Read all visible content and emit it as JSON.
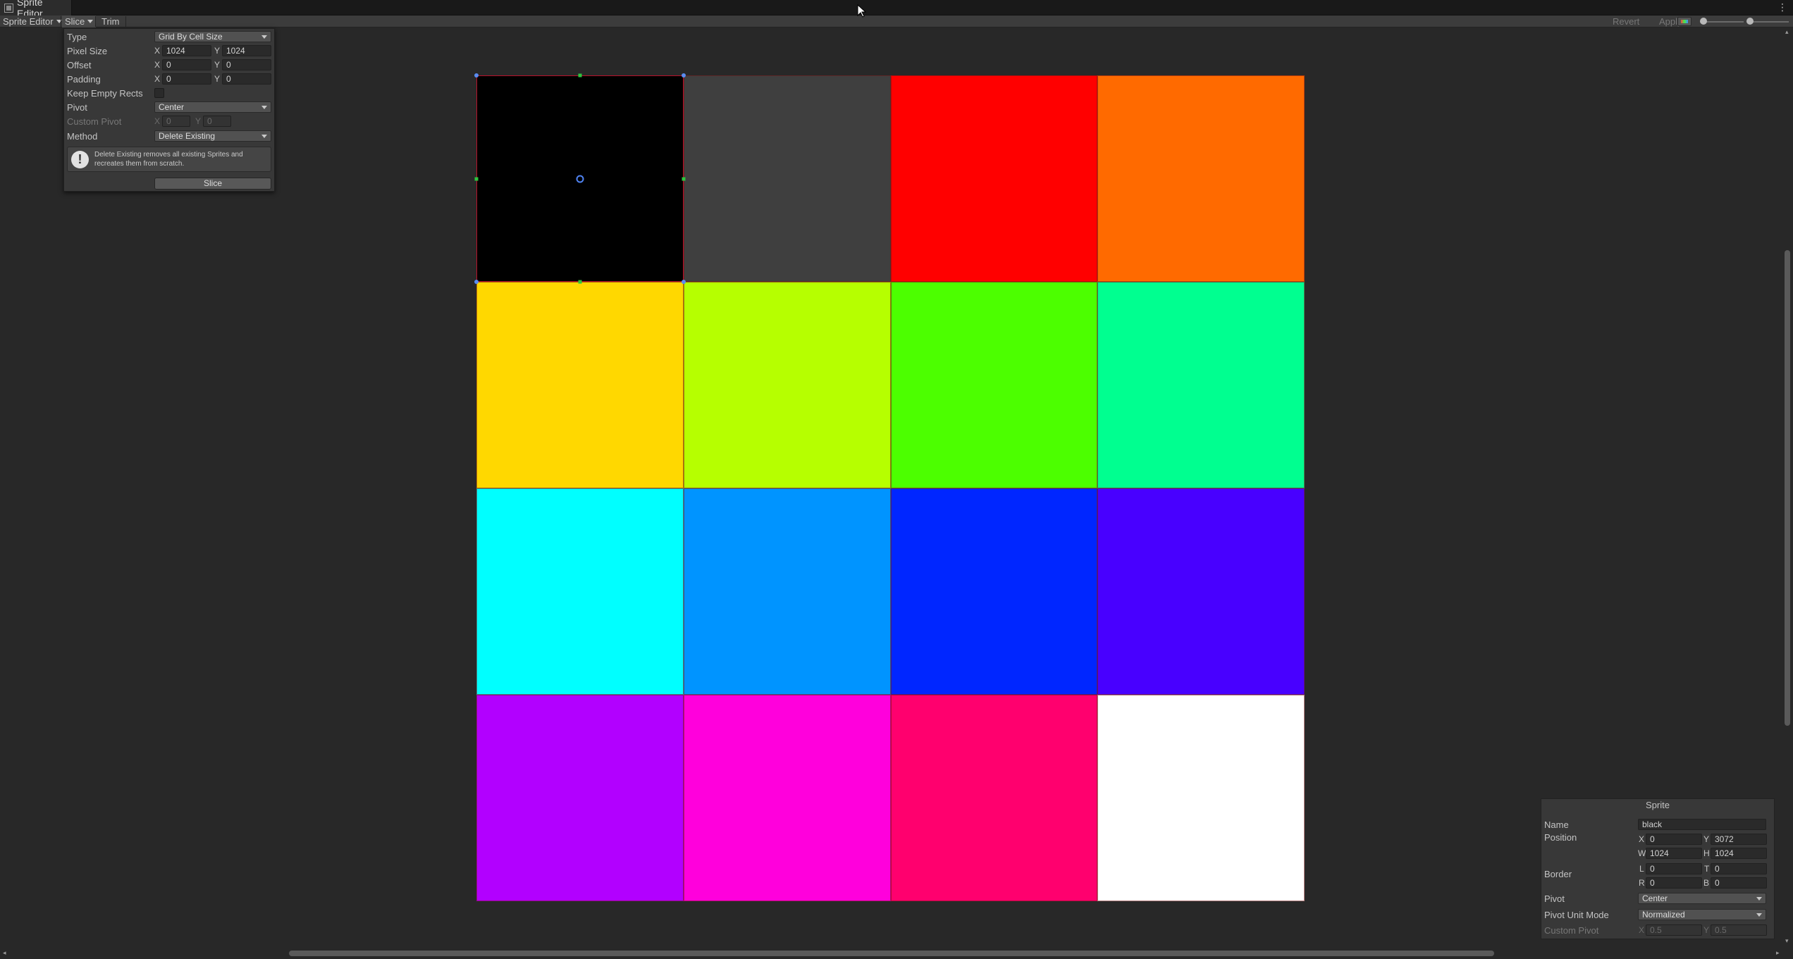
{
  "window": {
    "tab_title": "Sprite Editor",
    "kebab": "⋮"
  },
  "toolbar": {
    "mode_label": "Sprite Editor",
    "slice_label": "Slice",
    "trim_label": "Trim",
    "revert_label": "Revert",
    "apply_label": "Apply"
  },
  "slice_panel": {
    "type_label": "Type",
    "type_value": "Grid By Cell Size",
    "pixel_size_label": "Pixel Size",
    "pixel_size": {
      "x": "1024",
      "y": "1024"
    },
    "offset_label": "Offset",
    "offset": {
      "x": "0",
      "y": "0"
    },
    "padding_label": "Padding",
    "padding": {
      "x": "0",
      "y": "0"
    },
    "keep_empty_label": "Keep Empty Rects",
    "pivot_label": "Pivot",
    "pivot_value": "Center",
    "custom_pivot_label": "Custom Pivot",
    "custom_pivot": {
      "x": "0",
      "y": "0"
    },
    "method_label": "Method",
    "method_value": "Delete Existing",
    "help_icon": "!",
    "help_text": "Delete Existing removes all existing Sprites and recreates them from scratch.",
    "slice_button": "Slice",
    "axis_x": "X",
    "axis_y": "Y"
  },
  "grid": {
    "columns": 4,
    "rows": 4,
    "cells": [
      {
        "name": "black",
        "color": "#000000"
      },
      {
        "name": "dark-gray",
        "color": "#3f3f3f"
      },
      {
        "name": "red",
        "color": "#ff0000"
      },
      {
        "name": "orange",
        "color": "#ff6a00"
      },
      {
        "name": "yellow",
        "color": "#ffd800"
      },
      {
        "name": "lime",
        "color": "#b6ff00"
      },
      {
        "name": "green",
        "color": "#4cff00"
      },
      {
        "name": "spring-green",
        "color": "#00ff90"
      },
      {
        "name": "cyan",
        "color": "#00ffff"
      },
      {
        "name": "azure",
        "color": "#0094ff"
      },
      {
        "name": "blue",
        "color": "#0026ff"
      },
      {
        "name": "indigo",
        "color": "#4800ff"
      },
      {
        "name": "violet",
        "color": "#b200ff"
      },
      {
        "name": "magenta",
        "color": "#ff00dc"
      },
      {
        "name": "rose",
        "color": "#ff006e"
      },
      {
        "name": "white",
        "color": "#ffffff"
      }
    ]
  },
  "sprite_panel": {
    "title": "Sprite",
    "name_label": "Name",
    "name_value": "black",
    "position_label": "Position",
    "position": {
      "x": "0",
      "y": "3072",
      "w": "1024",
      "h": "1024"
    },
    "border_label": "Border",
    "border": {
      "l": "0",
      "t": "0",
      "r": "0",
      "b": "0"
    },
    "pivot_label": "Pivot",
    "pivot_value": "Center",
    "pivot_unit_label": "Pivot Unit Mode",
    "pivot_unit_value": "Normalized",
    "custom_pivot_label": "Custom Pivot",
    "custom_pivot": {
      "x": "0.5",
      "y": "0.5"
    },
    "axis": {
      "x": "X",
      "y": "Y",
      "w": "W",
      "h": "H",
      "l": "L",
      "t": "T",
      "r": "R",
      "b": "B"
    }
  },
  "scroll": {
    "left_arrow": "◂",
    "right_arrow": "▸",
    "up_arrow": "▴",
    "down_arrow": "▾"
  }
}
